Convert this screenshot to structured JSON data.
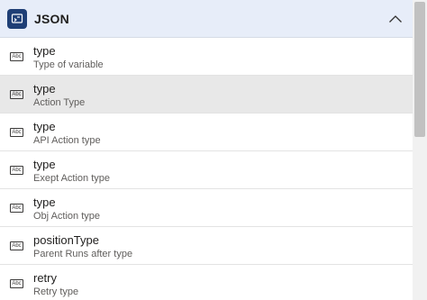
{
  "header": {
    "title": "JSON",
    "icon": "json-action-icon",
    "icon_bg": "#1f3f76",
    "collapse_icon": "chevron-up-icon"
  },
  "items": [
    {
      "title": "type",
      "subtitle": "Type of variable",
      "icon": "abc-text-icon",
      "icon_label": "Abc",
      "selected": false
    },
    {
      "title": "type",
      "subtitle": "Action Type",
      "icon": "abc-text-icon",
      "icon_label": "Abc",
      "selected": true
    },
    {
      "title": "type",
      "subtitle": "API Action type",
      "icon": "abc-text-icon",
      "icon_label": "Abc",
      "selected": false
    },
    {
      "title": "type",
      "subtitle": "Exept Action type",
      "icon": "abc-text-icon",
      "icon_label": "Abc",
      "selected": false
    },
    {
      "title": "type",
      "subtitle": "Obj Action type",
      "icon": "abc-text-icon",
      "icon_label": "Abc",
      "selected": false
    },
    {
      "title": "positionType",
      "subtitle": "Parent Runs after type",
      "icon": "abc-text-icon",
      "icon_label": "Abc",
      "selected": false
    },
    {
      "title": "retry",
      "subtitle": "Retry type",
      "icon": "abc-text-icon",
      "icon_label": "Abc",
      "selected": false
    }
  ],
  "colors": {
    "header_bg": "#e7edf9",
    "selected_bg": "#e8e8e8"
  }
}
